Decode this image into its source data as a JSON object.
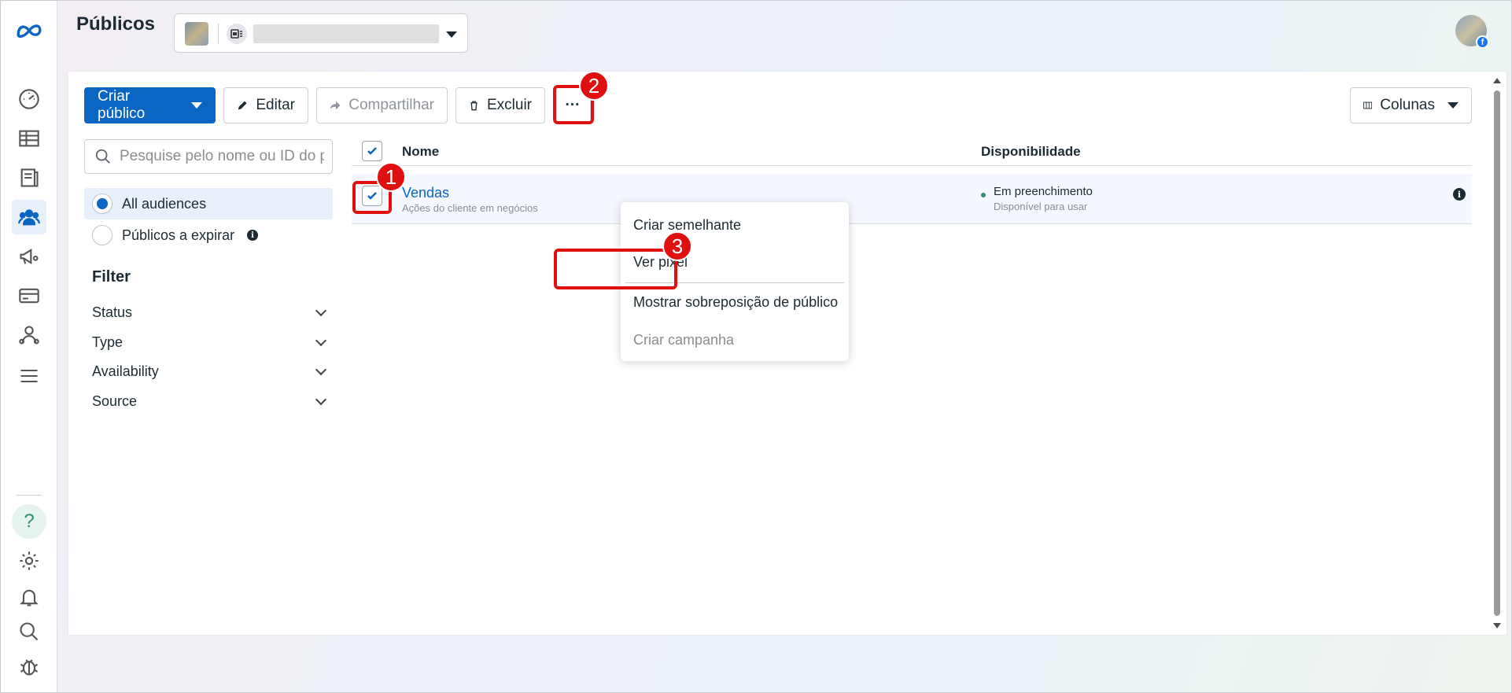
{
  "header": {
    "title": "Públicos"
  },
  "toolbar": {
    "create_audience": "Criar público",
    "edit": "Editar",
    "share": "Compartilhar",
    "delete": "Excluir",
    "more": "···",
    "columns": "Colunas"
  },
  "sidebar": {
    "search_placeholder": "Pesquise pelo nome ou ID do pú",
    "audiences": [
      {
        "label": "All audiences",
        "selected": true
      },
      {
        "label": "Públicos a expirar",
        "selected": false
      }
    ],
    "filter_title": "Filter",
    "filters": [
      "Status",
      "Type",
      "Availability",
      "Source"
    ]
  },
  "table": {
    "headers": {
      "name": "Nome",
      "availability": "Disponibilidade"
    },
    "rows": [
      {
        "name": "Vendas",
        "subtitle": "Ações do cliente em negócios",
        "availability": "Em preenchimento",
        "availability_sub": "Disponível para usar",
        "checked": true
      }
    ]
  },
  "menu": {
    "items": [
      "Criar semelhante",
      "Ver pixel",
      "Mostrar sobreposição de público",
      "Criar campanha"
    ]
  },
  "annotations": [
    "1",
    "2",
    "3"
  ],
  "colors": {
    "primary": "#0a66c2",
    "annotation": "#e01010",
    "status_dot": "#2f8f6d"
  },
  "icons": [
    "meta-logo-icon",
    "dashboard-icon",
    "table-icon",
    "catalog-icon",
    "audiences-icon",
    "campaign-icon",
    "billing-icon",
    "business-icon",
    "menu-icon",
    "help-icon",
    "settings-icon",
    "bell-icon",
    "search-icon",
    "bug-icon"
  ]
}
